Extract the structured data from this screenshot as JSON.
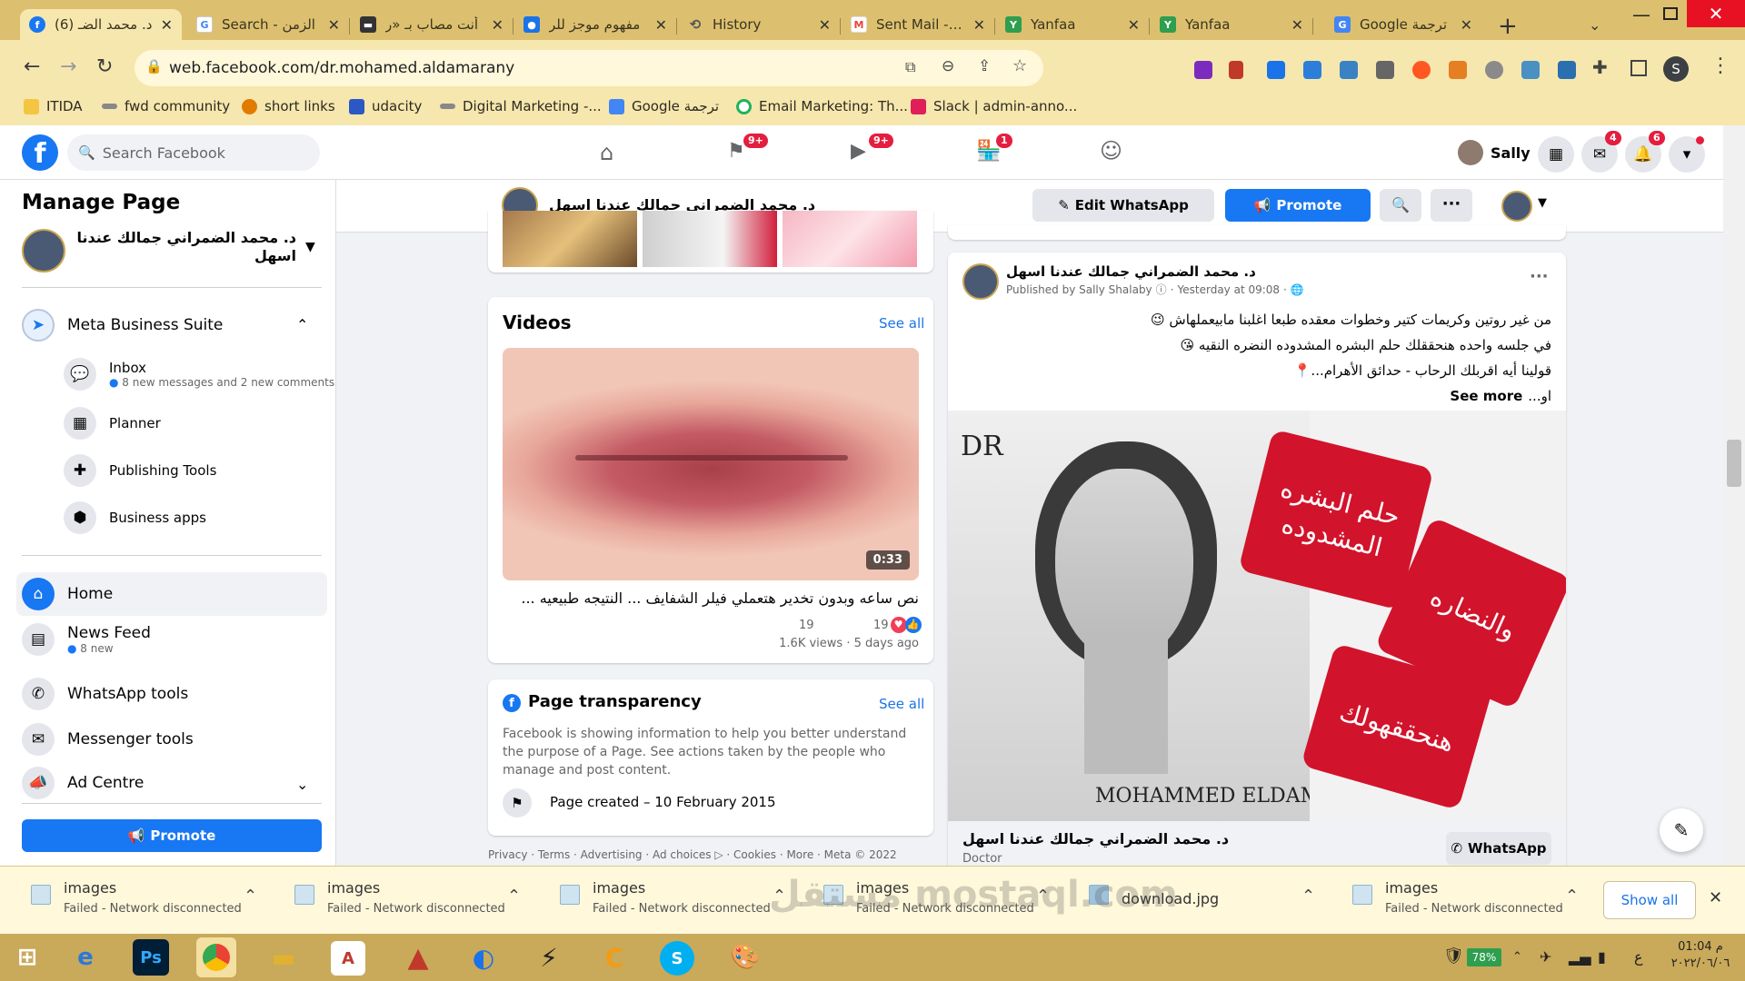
{
  "browser": {
    "tabs": [
      {
        "title": "(6) د. محمد الضـ",
        "favicon": "facebook-icon",
        "color": "#1877f2",
        "active": true
      },
      {
        "title": "Search - الزمن",
        "favicon": "google-icon",
        "color": "#4285f4"
      },
      {
        "title": "أنت مصاب بـ «ر",
        "favicon": "news-icon",
        "color": "#333333"
      },
      {
        "title": "مفهوم موجز للر",
        "favicon": "web-icon",
        "color": "#1a73e8"
      },
      {
        "title": "History",
        "favicon": "history-icon",
        "color": "#555555"
      },
      {
        "title": "Sent Mail - sal",
        "favicon": "gmail-icon",
        "color": "#ea4335"
      },
      {
        "title": "Yanfaa",
        "favicon": "yanfaa-icon",
        "color": "#2e9e4f"
      },
      {
        "title": "Yanfaa",
        "favicon": "yanfaa-icon",
        "color": "#2e9e4f"
      },
      {
        "title": "Google ترجمة",
        "favicon": "translate-icon",
        "color": "#4285f4"
      }
    ],
    "url": "web.facebook.com/dr.mohamed.aldamarany",
    "bookmarks": [
      {
        "label": "ITIDA",
        "color": "#f4c542"
      },
      {
        "label": "fwd community",
        "color": "#555555"
      },
      {
        "label": "short links",
        "color": "#e07b00"
      },
      {
        "label": "udacity",
        "color": "#2b58c5"
      },
      {
        "label": "Digital Marketing -...",
        "color": "#555555"
      },
      {
        "label": "Google ترجمة",
        "color": "#4285f4"
      },
      {
        "label": "Email Marketing: Th...",
        "color": "#1fb35a"
      },
      {
        "label": "Slack | admin-anno...",
        "color": "#e01e5a"
      }
    ],
    "profile_initial": "S"
  },
  "fb": {
    "search_placeholder": "Search Facebook",
    "nav_badges": [
      "9+",
      "9+",
      "1"
    ],
    "user_name": "Sally",
    "messenger_badge": "4",
    "notif_badge": "6"
  },
  "left": {
    "title": "Manage Page",
    "page_name": "د. محمد الضمراني جمالك عندنا اسهل",
    "mbs": "Meta Business Suite",
    "inbox": "Inbox",
    "inbox_sub": "8 new messages and 2 new comments",
    "planner": "Planner",
    "publishing": "Publishing Tools",
    "business_apps": "Business apps",
    "home": "Home",
    "news_feed": "News Feed",
    "news_sub": "8 new",
    "whatsapp": "WhatsApp tools",
    "messenger": "Messenger tools",
    "ad_centre": "Ad Centre",
    "promote": "Promote"
  },
  "subheader": {
    "page_name": "د. محمد الضمراني جمالك عندنا اسهل",
    "edit_whatsapp": "Edit WhatsApp",
    "promote": "Promote"
  },
  "videos": {
    "title": "Videos",
    "see_all": "See all",
    "duration": "0:33",
    "caption": "نص ساعه وبدون تخدير هتعملي فيلر الشفايف ... النتيجه طبيعيه ...",
    "reactions": "19",
    "comments": "19",
    "meta": "1.6K views · 5 days ago"
  },
  "transparency": {
    "title": "Page transparency",
    "see_all": "See all",
    "body": "Facebook is showing information to help you better understand the purpose of a Page. See actions taken by the people who manage and post content.",
    "created": "Page created – 10 February 2015"
  },
  "footer_links": "Privacy · Terms · Advertising · Ad choices ▷ · Cookies · More · Meta © 2022",
  "post": {
    "author": "د. محمد الضمراني جمالك عندنا اسهل",
    "published": "Published by Sally Shalaby",
    "time": "Yesterday at 09:08",
    "line1": "من غير روتين وكريمات كتير وخطوات معقده طبعا اغلبنا مابيعملهاش 😉",
    "line2": "في جلسه واحده هنحققلك حلم البشره المشدوده النضره النقيه 😘",
    "line3": "قولينا أيه اقربلك الرحاب - حدائق الأهرام...📍",
    "line4_prefix": "او...",
    "see_more": "See more",
    "img_dr": "DR",
    "img_tag1": "حلم البشره المشدوده",
    "img_tag2": "والنضاره",
    "img_tag3": "هنحققهولك",
    "img_name": "MOHAMMED ELDAMRANY",
    "cta_title": "د. محمد الضمراني جمالك عندنا اسهل",
    "cta_sub": "Doctor",
    "cta_button": "WhatsApp"
  },
  "downloads": {
    "items": [
      {
        "name": "images",
        "status": "Failed - Network disconnected"
      },
      {
        "name": "images",
        "status": "Failed - Network disconnected"
      },
      {
        "name": "images",
        "status": "Failed - Network disconnected"
      },
      {
        "name": "images",
        "status": "Failed - Network disconnected"
      },
      {
        "name": "download.jpg",
        "status": ""
      },
      {
        "name": "images",
        "status": "Failed - Network disconnected"
      }
    ],
    "show_all": "Show all"
  },
  "watermark": "مستقل mostaql.com",
  "taskbar": {
    "battery": "78%",
    "lang": "ع",
    "time": "01:04 م",
    "date": "٢٠٢٢/٠٦/٠٦"
  }
}
